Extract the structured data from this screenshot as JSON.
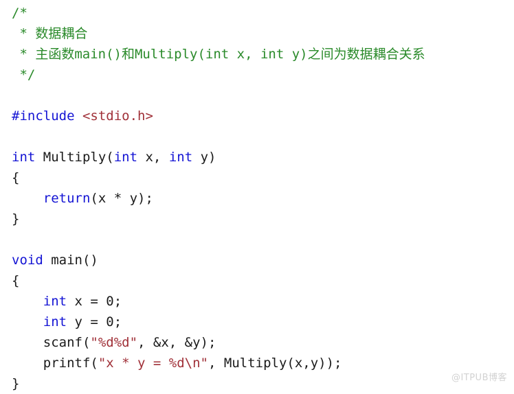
{
  "document": {
    "type": "c-source-code",
    "language": "C",
    "background_color": "#ffffff",
    "syntax_colors": {
      "comment": "#2a8a2a",
      "keyword": "#1414d4",
      "string": "#a03038",
      "plain": "#1a1a1a"
    }
  },
  "code": {
    "lines": [
      {
        "id": "line-1",
        "blank": false,
        "tokens": [
          {
            "cls": "tok-comment",
            "text": "/*"
          }
        ]
      },
      {
        "id": "line-2",
        "blank": false,
        "tokens": [
          {
            "cls": "tok-comment",
            "text": " * 数据耦合"
          }
        ]
      },
      {
        "id": "line-3",
        "blank": false,
        "tokens": [
          {
            "cls": "tok-comment",
            "text": " * 主函数main()和Multiply(int x, int y)之间为数据耦合关系"
          }
        ]
      },
      {
        "id": "line-4",
        "blank": false,
        "tokens": [
          {
            "cls": "tok-comment",
            "text": " */"
          }
        ]
      },
      {
        "id": "line-5",
        "blank": true,
        "tokens": []
      },
      {
        "id": "line-6",
        "blank": false,
        "tokens": [
          {
            "cls": "tok-keyword",
            "text": "#include"
          },
          {
            "cls": "tok-plain",
            "text": " "
          },
          {
            "cls": "tok-string",
            "text": "<stdio.h>"
          }
        ]
      },
      {
        "id": "line-7",
        "blank": true,
        "tokens": []
      },
      {
        "id": "line-8",
        "blank": false,
        "tokens": [
          {
            "cls": "tok-keyword",
            "text": "int"
          },
          {
            "cls": "tok-plain",
            "text": " Multiply("
          },
          {
            "cls": "tok-keyword",
            "text": "int"
          },
          {
            "cls": "tok-plain",
            "text": " x, "
          },
          {
            "cls": "tok-keyword",
            "text": "int"
          },
          {
            "cls": "tok-plain",
            "text": " y)"
          }
        ]
      },
      {
        "id": "line-9",
        "blank": false,
        "tokens": [
          {
            "cls": "tok-plain",
            "text": "{"
          }
        ]
      },
      {
        "id": "line-10",
        "blank": false,
        "tokens": [
          {
            "cls": "tok-plain",
            "text": "    "
          },
          {
            "cls": "tok-keyword",
            "text": "return"
          },
          {
            "cls": "tok-plain",
            "text": "(x * y);"
          }
        ]
      },
      {
        "id": "line-11",
        "blank": false,
        "tokens": [
          {
            "cls": "tok-plain",
            "text": "}"
          }
        ]
      },
      {
        "id": "line-12",
        "blank": true,
        "tokens": []
      },
      {
        "id": "line-13",
        "blank": false,
        "tokens": [
          {
            "cls": "tok-keyword",
            "text": "void"
          },
          {
            "cls": "tok-plain",
            "text": " main()"
          }
        ]
      },
      {
        "id": "line-14",
        "blank": false,
        "tokens": [
          {
            "cls": "tok-plain",
            "text": "{"
          }
        ]
      },
      {
        "id": "line-15",
        "blank": false,
        "tokens": [
          {
            "cls": "tok-plain",
            "text": "    "
          },
          {
            "cls": "tok-keyword",
            "text": "int"
          },
          {
            "cls": "tok-plain",
            "text": " x = 0;"
          }
        ]
      },
      {
        "id": "line-16",
        "blank": false,
        "tokens": [
          {
            "cls": "tok-plain",
            "text": "    "
          },
          {
            "cls": "tok-keyword",
            "text": "int"
          },
          {
            "cls": "tok-plain",
            "text": " y = 0;"
          }
        ]
      },
      {
        "id": "line-17",
        "blank": false,
        "tokens": [
          {
            "cls": "tok-plain",
            "text": "    scanf("
          },
          {
            "cls": "tok-string",
            "text": "\"%d%d\""
          },
          {
            "cls": "tok-plain",
            "text": ", &x, &y);"
          }
        ]
      },
      {
        "id": "line-18",
        "blank": false,
        "tokens": [
          {
            "cls": "tok-plain",
            "text": "    printf("
          },
          {
            "cls": "tok-string",
            "text": "\"x * y = %d\\n\""
          },
          {
            "cls": "tok-plain",
            "text": ", Multiply(x,y));"
          }
        ]
      },
      {
        "id": "line-19",
        "blank": false,
        "tokens": [
          {
            "cls": "tok-plain",
            "text": "}"
          }
        ]
      }
    ]
  },
  "watermark": {
    "text": "@ITPUB博客",
    "color": "#d2d2d2"
  }
}
